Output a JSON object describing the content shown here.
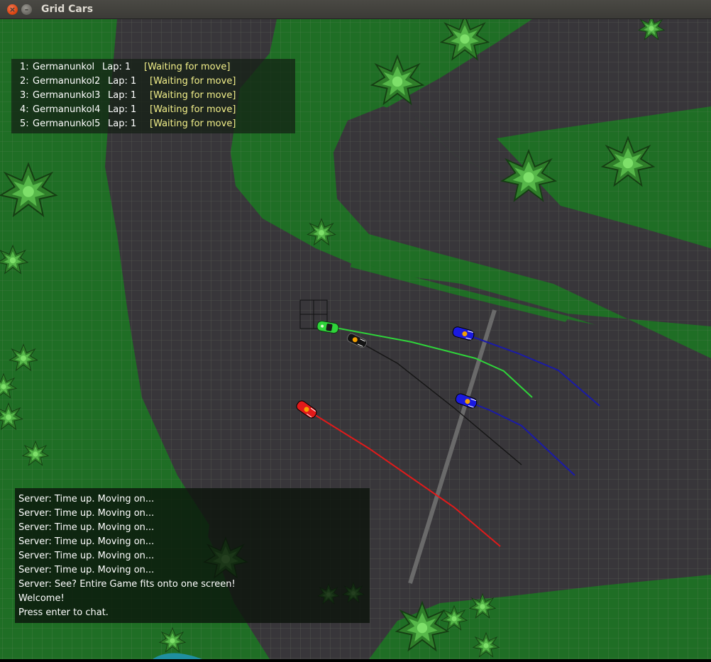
{
  "window": {
    "title": "Grid Cars",
    "close_glyph": "×",
    "minimize_glyph": "–"
  },
  "players": [
    {
      "rank": "1:",
      "name": "Germanunkol",
      "lap": "Lap: 1",
      "status": "[Waiting for move]"
    },
    {
      "rank": "2:",
      "name": "Germanunkol2",
      "lap": "Lap: 1",
      "status": "[Waiting for move]"
    },
    {
      "rank": "3:",
      "name": "Germanunkol3",
      "lap": "Lap: 1",
      "status": "[Waiting for move]"
    },
    {
      "rank": "4:",
      "name": "Germanunkol4",
      "lap": "Lap: 1",
      "status": "[Waiting for move]"
    },
    {
      "rank": "5:",
      "name": "Germanunkol5",
      "lap": "Lap: 1",
      "status": "[Waiting for move]"
    }
  ],
  "chat": {
    "lines": [
      "Server: Time up. Moving on...",
      "Server: Time up. Moving on...",
      "Server: Time up. Moving on...",
      "Server: Time up. Moving on...",
      "Server: Time up. Moving on...",
      "Server: Time up. Moving on...",
      "Server: See? Entire Game fits onto one screen!",
      "Welcome!",
      "Press enter to chat."
    ]
  },
  "colors": {
    "grass": "#1f6e25",
    "road": "#38363a",
    "grid": "#7d8a6e",
    "finish_line": "#6a6a6a",
    "tree": "#3f9a37",
    "green_car": "#2fd43a",
    "black_car": "#141414",
    "blue_car": "#1a1ae0",
    "red_car": "#e21a1a"
  },
  "cars": [
    {
      "name": "green-car",
      "color": "#2fd43a"
    },
    {
      "name": "black-car",
      "color": "#141414"
    },
    {
      "name": "blue-car-top",
      "color": "#1a1ae0"
    },
    {
      "name": "blue-car-bottom",
      "color": "#1a1ae0"
    },
    {
      "name": "red-car",
      "color": "#e21a1a"
    }
  ]
}
